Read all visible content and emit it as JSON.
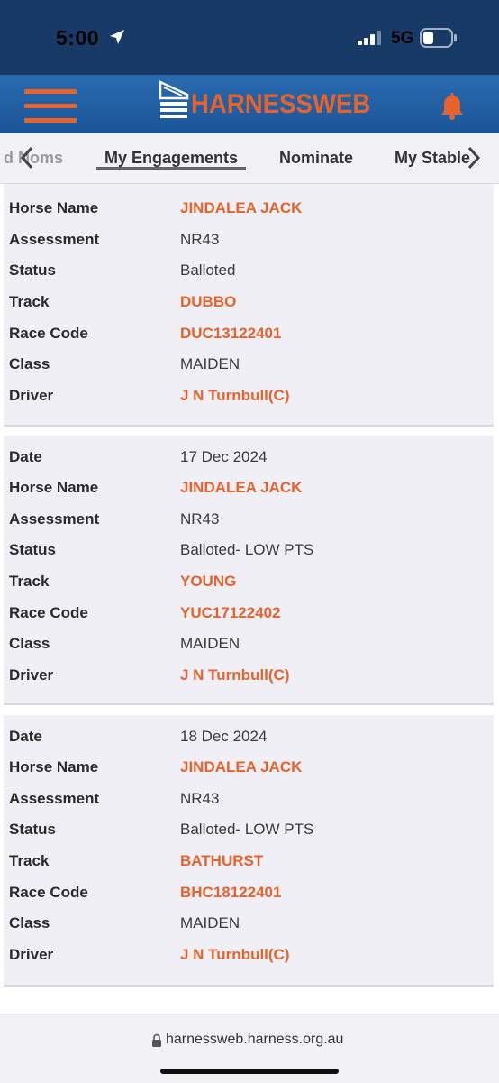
{
  "status_bar": {
    "time": "5:00",
    "network": "5G"
  },
  "app": {
    "logo_text": "HARNESSWEB",
    "accent_color": "#e8622c",
    "header_color": "#1b5598"
  },
  "tabs": [
    {
      "label": "d Noms"
    },
    {
      "label": "My Engagements"
    },
    {
      "label": "Nominate"
    },
    {
      "label": "My Stable"
    }
  ],
  "labels": {
    "date": "Date",
    "horse": "Horse Name",
    "assessment": "Assessment",
    "status": "Status",
    "track": "Track",
    "race_code": "Race Code",
    "class": "Class",
    "driver": "Driver"
  },
  "engagements": [
    {
      "horse": "JINDALEA JACK",
      "assessment": "NR43",
      "status": "Balloted",
      "track": "DUBBO",
      "race_code": "DUC13122401",
      "class": "MAIDEN",
      "driver": "J N Turnbull(C)"
    },
    {
      "date": "17 Dec 2024",
      "horse": "JINDALEA JACK",
      "assessment": "NR43",
      "status": "Balloted- LOW PTS",
      "track": "YOUNG",
      "race_code": "YUC17122402",
      "class": "MAIDEN",
      "driver": "J N Turnbull(C)"
    },
    {
      "date": "18 Dec 2024",
      "horse": "JINDALEA JACK",
      "assessment": "NR43",
      "status": "Balloted- LOW PTS",
      "track": "BATHURST",
      "race_code": "BHC18122401",
      "class": "MAIDEN",
      "driver": "J N Turnbull(C)"
    }
  ],
  "browser": {
    "url": "harnessweb.harness.org.au"
  }
}
